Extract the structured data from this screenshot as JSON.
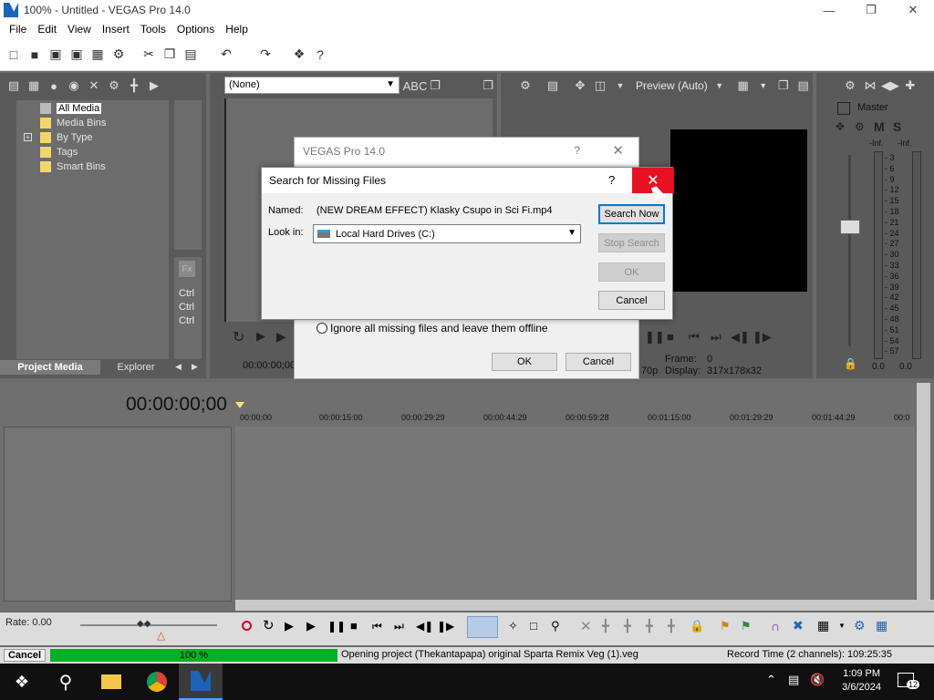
{
  "window": {
    "title": "100% - Untitled - VEGAS Pro 14.0"
  },
  "menu": [
    "File",
    "Edit",
    "View",
    "Insert",
    "Tools",
    "Options",
    "Help"
  ],
  "tree": [
    {
      "label": "All Media",
      "selected": true
    },
    {
      "label": "Media Bins"
    },
    {
      "label": "By Type",
      "expandable": true
    },
    {
      "label": "Tags"
    },
    {
      "label": "Smart Bins"
    }
  ],
  "project_tabs": [
    "Project Media",
    "Explorer"
  ],
  "trimmer": {
    "dropdown_value": "(None)",
    "tc": "00:00:00;00"
  },
  "preview": {
    "quality": "Preview (Auto)",
    "frame_label": "Frame:",
    "frame_value": "0",
    "display_label": "Display:",
    "display_value": "317x178x32",
    "fps_partial": "70p"
  },
  "master": {
    "title": "Master",
    "m_label": "M",
    "s_label": "S",
    "left_inf": "-Inf.",
    "right_inf": "-Inf.",
    "left_val": "0.0",
    "right_val": "0.0",
    "db_scale": [
      "3",
      "6",
      "9",
      "12",
      "15",
      "18",
      "21",
      "24",
      "27",
      "30",
      "33",
      "36",
      "39",
      "42",
      "45",
      "48",
      "51",
      "54",
      "57"
    ]
  },
  "outer_dialog": {
    "title": "VEGAS Pro 14.0",
    "help": "?",
    "radio_label": "Ignore all missing files and leave them offline",
    "ok": "OK",
    "cancel": "Cancel"
  },
  "search_dialog": {
    "title": "Search for Missing Files",
    "help": "?",
    "named_label": "Named:",
    "named_value": "(NEW DREAM EFFECT) Klasky Csupo in Sci Fi.mp4",
    "lookin_label": "Look in:",
    "lookin_value": "Local Hard Drives (C:)",
    "search_now": "Search Now",
    "stop_search": "Stop Search",
    "ok": "OK",
    "cancel": "Cancel"
  },
  "ctrl_labels": [
    "Ctrl",
    "Ctrl",
    "Ctrl"
  ],
  "timeline": {
    "timecode": "00:00:00;00",
    "ruler": [
      "00:00:00",
      "00:00:15:00",
      "00:00:29:29",
      "00:00:44:29",
      "00:00:59:28",
      "00:01:15:00",
      "00:01:29:29",
      "00:01:44:29",
      "00:0"
    ],
    "rate_label": "Rate: 0.00"
  },
  "status": {
    "cancel": "Cancel",
    "progress_text": "100 %",
    "progress": 1.0,
    "message": "Opening project (Thekantapapa) original Sparta Remix Veg (1).veg",
    "record_time": "Record Time (2 channels): 109:25:35"
  },
  "taskbar": {
    "time": "1:09 PM",
    "date": "3/6/2024",
    "notif_count": "12"
  },
  "colors": {
    "accent": "#0078d7",
    "close_red": "#e81123",
    "progress_green": "#06b025"
  }
}
